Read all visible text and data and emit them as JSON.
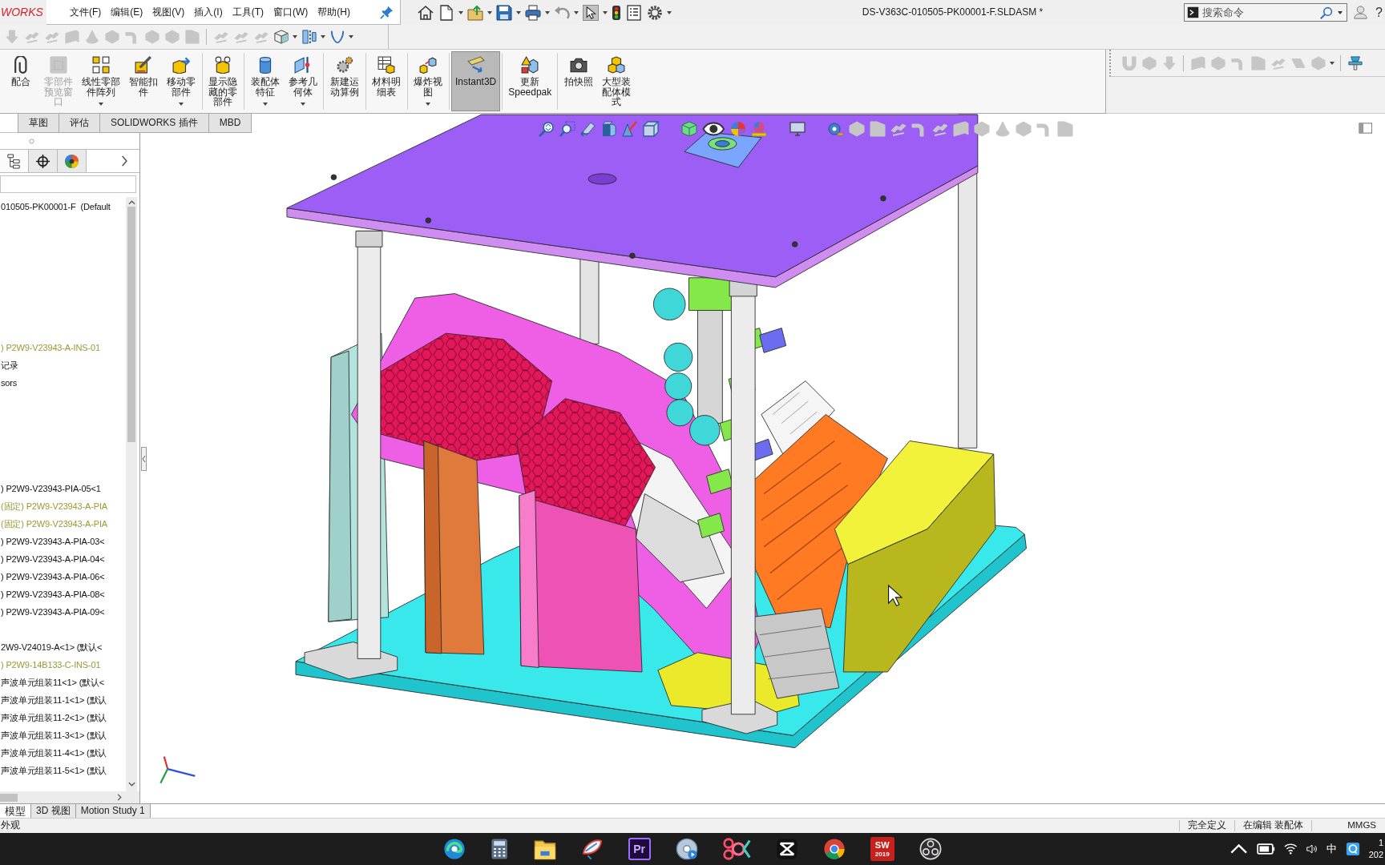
{
  "app_logo": {
    "text": "WORKS"
  },
  "menu": [
    {
      "label": "文件(F)"
    },
    {
      "label": "编辑(E)"
    },
    {
      "label": "视图(V)"
    },
    {
      "label": "插入(I)"
    },
    {
      "label": "工具(T)"
    },
    {
      "label": "窗口(W)"
    },
    {
      "label": "帮助(H)"
    }
  ],
  "quick_access": [
    {
      "kind": "home",
      "has_menu": false,
      "pressed": false,
      "disabled": false
    },
    {
      "kind": "new",
      "has_menu": true,
      "pressed": false,
      "disabled": false
    },
    {
      "kind": "open",
      "has_menu": true,
      "pressed": false,
      "disabled": false
    },
    {
      "kind": "save",
      "has_menu": true,
      "pressed": false,
      "disabled": false
    },
    {
      "kind": "print",
      "has_menu": true,
      "pressed": false,
      "disabled": false
    },
    {
      "kind": "undo",
      "has_menu": true,
      "pressed": false,
      "disabled": true
    },
    {
      "kind": "select",
      "has_menu": true,
      "pressed": true,
      "disabled": false
    },
    {
      "kind": "rebuild",
      "has_menu": false,
      "pressed": false,
      "disabled": false
    },
    {
      "kind": "properties",
      "has_menu": false,
      "pressed": false,
      "disabled": false
    },
    {
      "kind": "options",
      "has_menu": true,
      "pressed": false,
      "disabled": false
    }
  ],
  "window_title": "DS-V363C-010505-PK00001-F.SLDASM *",
  "search": {
    "placeholder": "搜索命令"
  },
  "help": {
    "label": "?"
  },
  "secondary_toolbar": [
    [
      {
        "kind": "down",
        "disabled": true,
        "has_menu": false
      },
      {
        "kind": "link",
        "disabled": true,
        "has_menu": false
      },
      {
        "kind": "link",
        "disabled": true,
        "has_menu": false
      },
      {
        "kind": "sheet",
        "disabled": true,
        "has_menu": false
      },
      {
        "kind": "cone",
        "disabled": true,
        "has_menu": false
      },
      {
        "kind": "box",
        "disabled": true,
        "has_menu": false
      },
      {
        "kind": "bend",
        "disabled": true,
        "has_menu": false
      },
      {
        "kind": "box",
        "disabled": true,
        "has_menu": false
      },
      {
        "kind": "box",
        "disabled": true,
        "has_menu": false
      },
      {
        "kind": "fold",
        "disabled": true,
        "has_menu": false
      }
    ],
    [
      {
        "kind": "link",
        "disabled": true,
        "has_menu": false
      },
      {
        "kind": "link",
        "disabled": true,
        "has_menu": false
      },
      {
        "kind": "link",
        "disabled": true,
        "has_menu": false
      },
      {
        "kind": "cube",
        "disabled": false,
        "has_menu": true
      },
      {
        "kind": "split",
        "disabled": false,
        "has_menu": true
      },
      {
        "kind": "curve",
        "disabled": false,
        "has_menu": true
      }
    ]
  ],
  "command_manager": [
    [
      {
        "label": "配合",
        "kind": "mate",
        "has_menu": false,
        "disabled": false,
        "pressed": false
      },
      {
        "label": "零部件预览窗口",
        "kind": "preview",
        "has_menu": false,
        "disabled": true,
        "pressed": false
      },
      {
        "label": "线性零部件阵列",
        "kind": "pattern",
        "has_menu": true,
        "disabled": false,
        "pressed": false
      },
      {
        "label": "智能扣件",
        "kind": "fastener",
        "has_menu": false,
        "disabled": false,
        "pressed": false
      },
      {
        "label": "移动零部件",
        "kind": "move",
        "has_menu": true,
        "disabled": false,
        "pressed": false
      }
    ],
    [
      {
        "label": "显示隐藏的零部件",
        "kind": "showhidden",
        "has_menu": false,
        "disabled": false,
        "pressed": false
      }
    ],
    [
      {
        "label": "装配体特征",
        "kind": "asmfeature",
        "has_menu": true,
        "disabled": false,
        "pressed": false
      },
      {
        "label": "参考几何体",
        "kind": "refgeo",
        "has_menu": true,
        "disabled": false,
        "pressed": false
      }
    ],
    [
      {
        "label": "新建运动算例",
        "kind": "motion",
        "has_menu": false,
        "disabled": false,
        "pressed": false
      }
    ],
    [
      {
        "label": "材料明细表",
        "kind": "bom",
        "has_menu": false,
        "disabled": false,
        "pressed": false
      }
    ],
    [
      {
        "label": "爆炸视图",
        "kind": "explode",
        "has_menu": true,
        "disabled": false,
        "pressed": false
      }
    ],
    [
      {
        "label": "Instant3D",
        "kind": "instant3d",
        "has_menu": false,
        "disabled": false,
        "pressed": true
      }
    ],
    [
      {
        "label": "更新 Speedpak",
        "kind": "speedpak",
        "has_menu": false,
        "disabled": false,
        "pressed": false
      }
    ],
    [
      {
        "label": "拍快照",
        "kind": "camera",
        "has_menu": false,
        "disabled": false,
        "pressed": false
      },
      {
        "label": "大型装配体模式",
        "kind": "largeasm",
        "has_menu": false,
        "disabled": false,
        "pressed": false
      }
    ]
  ],
  "right_toolbar": [
    [
      {
        "kind": "ubend",
        "disabled": true,
        "has_menu": false
      },
      {
        "kind": "box",
        "disabled": true,
        "has_menu": false
      },
      {
        "kind": "down",
        "disabled": true,
        "has_menu": false
      }
    ],
    [
      {
        "kind": "sheet",
        "disabled": true,
        "has_menu": false
      },
      {
        "kind": "box",
        "disabled": true,
        "has_menu": false
      },
      {
        "kind": "bend",
        "disabled": true,
        "has_menu": false
      },
      {
        "kind": "fold",
        "disabled": true,
        "has_menu": false
      },
      {
        "kind": "link",
        "disabled": true,
        "has_menu": false
      },
      {
        "kind": "plane",
        "disabled": true,
        "has_menu": false
      },
      {
        "kind": "box",
        "disabled": true,
        "has_menu": true
      }
    ],
    [
      {
        "kind": "stamp",
        "disabled": false,
        "has_menu": false
      }
    ]
  ],
  "command_tabs": [
    {
      "label": "草图",
      "selected": false
    },
    {
      "label": "评估",
      "selected": false
    },
    {
      "label": "SOLIDWORKS 插件",
      "selected": false
    },
    {
      "label": "MBD",
      "selected": false
    }
  ],
  "feature_manager": {
    "tabs": [
      {
        "kind": "tree",
        "selected": true
      },
      {
        "kind": "property",
        "selected": false
      },
      {
        "kind": "display",
        "selected": false
      }
    ],
    "tree": [
      {
        "text": "010505-PK00001-F  (Default"
      },
      {
        "text": ") P2W9-V23943-A-INS-01",
        "color": "#9a9a38"
      },
      {
        "text": "记录"
      },
      {
        "text": "sors"
      },
      {
        "text": ") P2W9-V23943-PIA-05<1"
      },
      {
        "text": "(固定) P2W9-V23943-A-PIA",
        "color": "#9a9a38"
      },
      {
        "text": "(固定) P2W9-V23943-A-PIA",
        "color": "#9a9a38"
      },
      {
        "text": ") P2W9-V23943-A-PIA-03<"
      },
      {
        "text": ") P2W9-V23943-A-PIA-04<"
      },
      {
        "text": ") P2W9-V23943-A-PIA-06<"
      },
      {
        "text": ") P2W9-V23943-A-PIA-08<"
      },
      {
        "text": ") P2W9-V23943-A-PIA-09<"
      },
      {
        "text": "2W9-V24019-A<1> (默认<"
      },
      {
        "text": ") P2W9-14B133-C-INS-01",
        "color": "#9a9a38"
      },
      {
        "text": "声波单元组装11<1> (默认<"
      },
      {
        "text": "声波单元组装11-1<1> (默认"
      },
      {
        "text": "声波单元组装11-2<1> (默认"
      },
      {
        "text": "声波单元组装11-3<1> (默认"
      },
      {
        "text": "声波单元组装11-4<1> (默认"
      },
      {
        "text": "声波单元组装11-5<1> (默认"
      }
    ]
  },
  "view_toolbar": [
    [
      {
        "kind": "zoomfit",
        "disabled": false
      },
      {
        "kind": "zoomarea",
        "disabled": false
      },
      {
        "kind": "prevview",
        "disabled": false
      },
      {
        "kind": "section",
        "disabled": false
      },
      {
        "kind": "annotation",
        "disabled": false
      },
      {
        "kind": "viewcube",
        "disabled": false
      }
    ],
    [
      {
        "kind": "display",
        "disabled": false
      },
      {
        "kind": "eye",
        "disabled": false
      },
      {
        "kind": "appearance",
        "disabled": false
      },
      {
        "kind": "scene",
        "disabled": false
      }
    ],
    [
      {
        "kind": "monitor",
        "disabled": false
      }
    ],
    [
      {
        "kind": "measure",
        "disabled": false
      },
      {
        "kind": "box",
        "disabled": true
      },
      {
        "kind": "fold",
        "disabled": true
      },
      {
        "kind": "link",
        "disabled": true
      },
      {
        "kind": "bend",
        "disabled": true
      },
      {
        "kind": "link",
        "disabled": true
      },
      {
        "kind": "sheet",
        "disabled": true
      },
      {
        "kind": "box",
        "disabled": true
      },
      {
        "kind": "cone",
        "disabled": true
      },
      {
        "kind": "box",
        "disabled": true
      },
      {
        "kind": "bend",
        "disabled": true
      },
      {
        "kind": "fold",
        "disabled": true
      }
    ]
  ],
  "bottom_tabs": [
    {
      "label": "模型",
      "selected": true
    },
    {
      "label": "3D 视图",
      "selected": false
    },
    {
      "label": "Motion Study 1",
      "selected": false
    }
  ],
  "status_bar": {
    "message": "外观",
    "fields": [
      "完全定义",
      "在编辑 装配体",
      "MMGS"
    ]
  },
  "taskbar": {
    "apps": [
      {
        "kind": "edge"
      },
      {
        "kind": "calc"
      },
      {
        "kind": "folder"
      },
      {
        "kind": "feather"
      },
      {
        "kind": "pr",
        "label": "Pr"
      },
      {
        "kind": "disc"
      },
      {
        "kind": "rings"
      },
      {
        "kind": "capcut"
      },
      {
        "kind": "chrome"
      },
      {
        "kind": "sw",
        "label": "SW",
        "sublabel": "2019"
      },
      {
        "kind": "obs"
      }
    ],
    "tray": [
      {
        "kind": "chevron"
      },
      {
        "kind": "battery"
      },
      {
        "kind": "wifi"
      },
      {
        "kind": "speaker"
      },
      {
        "kind": "ime",
        "label": "中"
      },
      {
        "kind": "qapp"
      }
    ],
    "clock": {
      "time": "1",
      "date": "202"
    }
  }
}
